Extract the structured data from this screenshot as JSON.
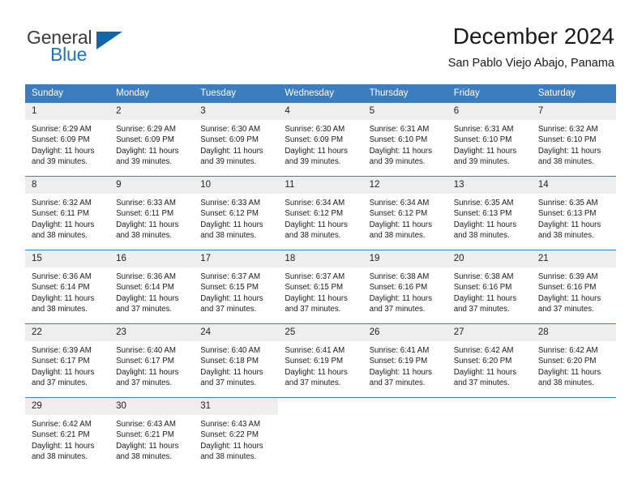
{
  "brand": {
    "name_part1": "General",
    "name_part2": "Blue",
    "triangle_color": "#1264ab",
    "blue_color": "#1e73be",
    "gray_color": "#3b3b3b"
  },
  "header": {
    "title": "December 2024",
    "subtitle": "San Pablo Viejo Abajo, Panama"
  },
  "theme": {
    "header_bg": "#3b7dbf",
    "daynum_bg": "#eeeeee",
    "text": "#1a1a1a"
  },
  "weekdays": [
    "Sunday",
    "Monday",
    "Tuesday",
    "Wednesday",
    "Thursday",
    "Friday",
    "Saturday"
  ],
  "weeks": [
    [
      {
        "day": "1",
        "sunrise": "Sunrise: 6:29 AM",
        "sunset": "Sunset: 6:09 PM",
        "daylight": "Daylight: 11 hours and 39 minutes."
      },
      {
        "day": "2",
        "sunrise": "Sunrise: 6:29 AM",
        "sunset": "Sunset: 6:09 PM",
        "daylight": "Daylight: 11 hours and 39 minutes."
      },
      {
        "day": "3",
        "sunrise": "Sunrise: 6:30 AM",
        "sunset": "Sunset: 6:09 PM",
        "daylight": "Daylight: 11 hours and 39 minutes."
      },
      {
        "day": "4",
        "sunrise": "Sunrise: 6:30 AM",
        "sunset": "Sunset: 6:09 PM",
        "daylight": "Daylight: 11 hours and 39 minutes."
      },
      {
        "day": "5",
        "sunrise": "Sunrise: 6:31 AM",
        "sunset": "Sunset: 6:10 PM",
        "daylight": "Daylight: 11 hours and 39 minutes."
      },
      {
        "day": "6",
        "sunrise": "Sunrise: 6:31 AM",
        "sunset": "Sunset: 6:10 PM",
        "daylight": "Daylight: 11 hours and 39 minutes."
      },
      {
        "day": "7",
        "sunrise": "Sunrise: 6:32 AM",
        "sunset": "Sunset: 6:10 PM",
        "daylight": "Daylight: 11 hours and 38 minutes."
      }
    ],
    [
      {
        "day": "8",
        "sunrise": "Sunrise: 6:32 AM",
        "sunset": "Sunset: 6:11 PM",
        "daylight": "Daylight: 11 hours and 38 minutes."
      },
      {
        "day": "9",
        "sunrise": "Sunrise: 6:33 AM",
        "sunset": "Sunset: 6:11 PM",
        "daylight": "Daylight: 11 hours and 38 minutes."
      },
      {
        "day": "10",
        "sunrise": "Sunrise: 6:33 AM",
        "sunset": "Sunset: 6:12 PM",
        "daylight": "Daylight: 11 hours and 38 minutes."
      },
      {
        "day": "11",
        "sunrise": "Sunrise: 6:34 AM",
        "sunset": "Sunset: 6:12 PM",
        "daylight": "Daylight: 11 hours and 38 minutes."
      },
      {
        "day": "12",
        "sunrise": "Sunrise: 6:34 AM",
        "sunset": "Sunset: 6:12 PM",
        "daylight": "Daylight: 11 hours and 38 minutes."
      },
      {
        "day": "13",
        "sunrise": "Sunrise: 6:35 AM",
        "sunset": "Sunset: 6:13 PM",
        "daylight": "Daylight: 11 hours and 38 minutes."
      },
      {
        "day": "14",
        "sunrise": "Sunrise: 6:35 AM",
        "sunset": "Sunset: 6:13 PM",
        "daylight": "Daylight: 11 hours and 38 minutes."
      }
    ],
    [
      {
        "day": "15",
        "sunrise": "Sunrise: 6:36 AM",
        "sunset": "Sunset: 6:14 PM",
        "daylight": "Daylight: 11 hours and 38 minutes."
      },
      {
        "day": "16",
        "sunrise": "Sunrise: 6:36 AM",
        "sunset": "Sunset: 6:14 PM",
        "daylight": "Daylight: 11 hours and 37 minutes."
      },
      {
        "day": "17",
        "sunrise": "Sunrise: 6:37 AM",
        "sunset": "Sunset: 6:15 PM",
        "daylight": "Daylight: 11 hours and 37 minutes."
      },
      {
        "day": "18",
        "sunrise": "Sunrise: 6:37 AM",
        "sunset": "Sunset: 6:15 PM",
        "daylight": "Daylight: 11 hours and 37 minutes."
      },
      {
        "day": "19",
        "sunrise": "Sunrise: 6:38 AM",
        "sunset": "Sunset: 6:16 PM",
        "daylight": "Daylight: 11 hours and 37 minutes."
      },
      {
        "day": "20",
        "sunrise": "Sunrise: 6:38 AM",
        "sunset": "Sunset: 6:16 PM",
        "daylight": "Daylight: 11 hours and 37 minutes."
      },
      {
        "day": "21",
        "sunrise": "Sunrise: 6:39 AM",
        "sunset": "Sunset: 6:16 PM",
        "daylight": "Daylight: 11 hours and 37 minutes."
      }
    ],
    [
      {
        "day": "22",
        "sunrise": "Sunrise: 6:39 AM",
        "sunset": "Sunset: 6:17 PM",
        "daylight": "Daylight: 11 hours and 37 minutes."
      },
      {
        "day": "23",
        "sunrise": "Sunrise: 6:40 AM",
        "sunset": "Sunset: 6:17 PM",
        "daylight": "Daylight: 11 hours and 37 minutes."
      },
      {
        "day": "24",
        "sunrise": "Sunrise: 6:40 AM",
        "sunset": "Sunset: 6:18 PM",
        "daylight": "Daylight: 11 hours and 37 minutes."
      },
      {
        "day": "25",
        "sunrise": "Sunrise: 6:41 AM",
        "sunset": "Sunset: 6:19 PM",
        "daylight": "Daylight: 11 hours and 37 minutes."
      },
      {
        "day": "26",
        "sunrise": "Sunrise: 6:41 AM",
        "sunset": "Sunset: 6:19 PM",
        "daylight": "Daylight: 11 hours and 37 minutes."
      },
      {
        "day": "27",
        "sunrise": "Sunrise: 6:42 AM",
        "sunset": "Sunset: 6:20 PM",
        "daylight": "Daylight: 11 hours and 37 minutes."
      },
      {
        "day": "28",
        "sunrise": "Sunrise: 6:42 AM",
        "sunset": "Sunset: 6:20 PM",
        "daylight": "Daylight: 11 hours and 38 minutes."
      }
    ],
    [
      {
        "day": "29",
        "sunrise": "Sunrise: 6:42 AM",
        "sunset": "Sunset: 6:21 PM",
        "daylight": "Daylight: 11 hours and 38 minutes."
      },
      {
        "day": "30",
        "sunrise": "Sunrise: 6:43 AM",
        "sunset": "Sunset: 6:21 PM",
        "daylight": "Daylight: 11 hours and 38 minutes."
      },
      {
        "day": "31",
        "sunrise": "Sunrise: 6:43 AM",
        "sunset": "Sunset: 6:22 PM",
        "daylight": "Daylight: 11 hours and 38 minutes."
      },
      {
        "day": "",
        "sunrise": "",
        "sunset": "",
        "daylight": ""
      },
      {
        "day": "",
        "sunrise": "",
        "sunset": "",
        "daylight": ""
      },
      {
        "day": "",
        "sunrise": "",
        "sunset": "",
        "daylight": ""
      },
      {
        "day": "",
        "sunrise": "",
        "sunset": "",
        "daylight": ""
      }
    ]
  ]
}
